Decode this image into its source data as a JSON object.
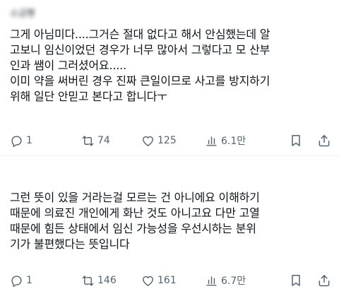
{
  "posts": [
    {
      "author": "소금빵",
      "text": "그게 아님미다....그거슨 절대 없다고 해서 안심했는데 알\n고보니 임신이었던 경우가 너무 많아서 그렇다고 모 산부\n인과 쌤이 그러셨어요.....\n이미 약을 써버린 경우 진짜 큰일이므로 사고를 방지하기\n위해 일단 안믿고 본다고 합니다ㅜ",
      "stats": {
        "replies": "1",
        "retweets": "74",
        "likes": "125",
        "views": "6.1만"
      }
    },
    {
      "author": "",
      "text": "그런 뜻이 있을 거라는걸 모르는 건 아니에요 이해하기\n때문에 의료진 개인에게 화난 것도 아니고요 다만 고열\n때문에 힘든 상태에서 임신 가능성을 우선시하는 분위\n기가 불편했다는 뜻입니다",
      "stats": {
        "replies": "1",
        "retweets": "146",
        "likes": "161",
        "views": "6.7만"
      }
    }
  ],
  "icons": {
    "reply": "reply-icon",
    "retweet": "retweet-icon",
    "like": "heart-icon",
    "views": "views-icon",
    "bookmark": "bookmark-icon",
    "share": "share-icon"
  },
  "colors": {
    "text": "#0f1419",
    "muted": "#536471",
    "divider": "#eff3f4"
  }
}
